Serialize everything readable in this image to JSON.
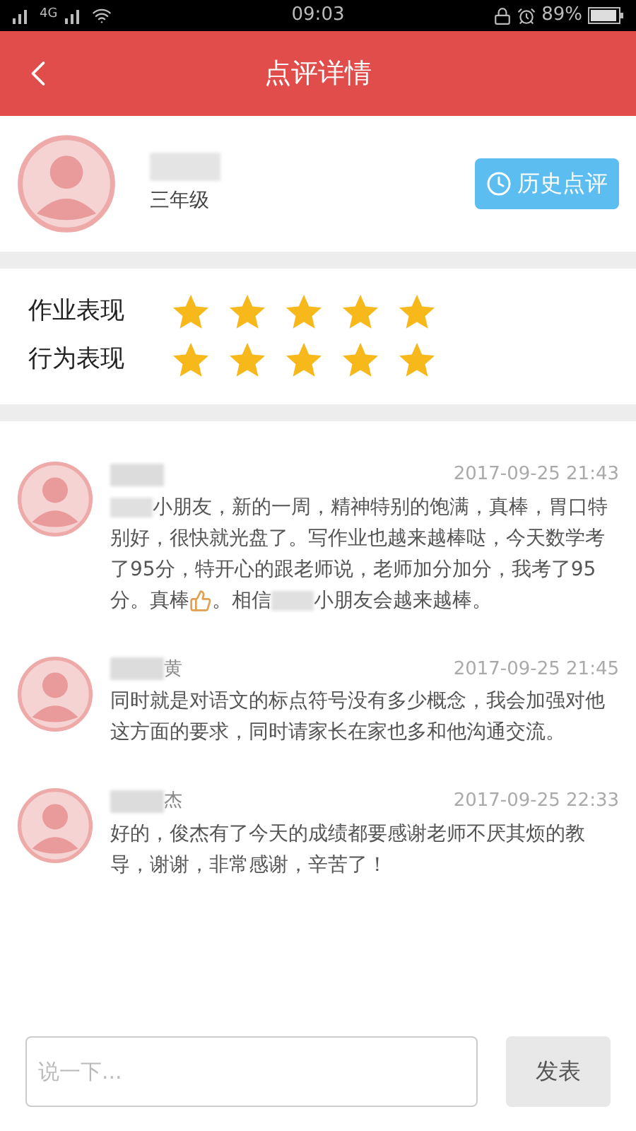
{
  "status_bar": {
    "network": "4G",
    "time": "09:03",
    "battery": "89%"
  },
  "header": {
    "title": "点评详情"
  },
  "student": {
    "grade": "三年级",
    "history_button": "历史点评"
  },
  "ratings": [
    {
      "label": "作业表现",
      "stars": 5
    },
    {
      "label": "行为表现",
      "stars": 5
    }
  ],
  "comments": [
    {
      "time": "2017-09-25 21:43",
      "parts": [
        {
          "kind": "blur"
        },
        {
          "kind": "text",
          "text": "小朋友，新的一周，精神特别的饱满，真棒，胃口特别好，很快就光盘了。写作业也越来越棒哒，今天数学考了95分，特开心的跟老师说，老师加分加分，我考了95分。真棒"
        },
        {
          "kind": "thumb"
        },
        {
          "kind": "text",
          "text": "。相信"
        },
        {
          "kind": "blur"
        },
        {
          "kind": "text",
          "text": "小朋友会越来越棒。"
        }
      ]
    },
    {
      "name_suffix": "黄",
      "time": "2017-09-25 21:45",
      "parts": [
        {
          "kind": "text",
          "text": "同时就是对语文的标点符号没有多少概念，我会加强对他这方面的要求，同时请家长在家也多和他沟通交流。"
        }
      ]
    },
    {
      "name_suffix": "杰",
      "time": "2017-09-25 22:33",
      "parts": [
        {
          "kind": "text",
          "text": "好的，俊杰有了今天的成绩都要感谢老师不厌其烦的教导，谢谢，非常感谢，辛苦了！"
        }
      ]
    }
  ],
  "composer": {
    "placeholder": "说一下...",
    "send": "发表"
  }
}
